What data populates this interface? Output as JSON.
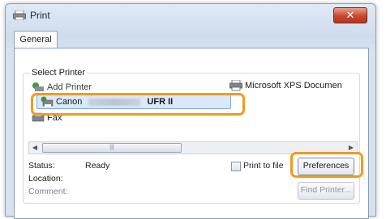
{
  "window": {
    "title": "Print",
    "close_glyph": "✕"
  },
  "tabs": [
    {
      "label": "General"
    }
  ],
  "select_printer": {
    "group_label": "Select Printer",
    "printers": [
      {
        "name": "Add Printer",
        "icon": "add-printer-icon"
      },
      {
        "name": "Microsoft XPS Documen",
        "icon": "printer-icon"
      },
      {
        "name_prefix": "Canon",
        "name_suffix": "UFR II",
        "icon": "canon-printer-icon",
        "selected": true
      },
      {
        "name": "Fax",
        "icon": "fax-icon"
      }
    ],
    "scroll_thumb_glyph": "|||"
  },
  "status": {
    "status_label": "Status:",
    "status_value": "Ready",
    "location_label": "Location:",
    "comment_label": "Comment:"
  },
  "actions": {
    "print_to_file_label": "Print to file",
    "preferences_label": "Preferences",
    "find_printer_label": "Find Printer..."
  },
  "colors": {
    "highlight": "#f39a1e",
    "selection": "#d8e9fb"
  }
}
